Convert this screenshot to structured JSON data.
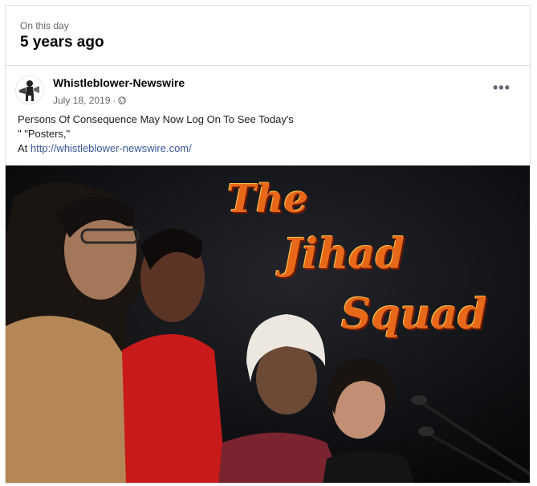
{
  "memory": {
    "label": "On this day",
    "heading": "5 years ago"
  },
  "post": {
    "author": "Whistleblower-Newswire",
    "date": "July 18, 2019",
    "separator": "·",
    "privacy_icon": "globe-icon",
    "more_label": "•••",
    "text_line1": "Persons Of Consequence May Now Log On To See Today's",
    "text_line2": "\" \"Posters,\"",
    "text_line3_prefix": "At ",
    "link": "http://whistleblower-newswire.com/"
  },
  "image": {
    "title_line1": "The",
    "title_line2": "Jihad",
    "title_line3": "Squad"
  },
  "colors": {
    "link": "#385898",
    "secondary_text": "#65676b",
    "title_text": "#e8681a"
  }
}
